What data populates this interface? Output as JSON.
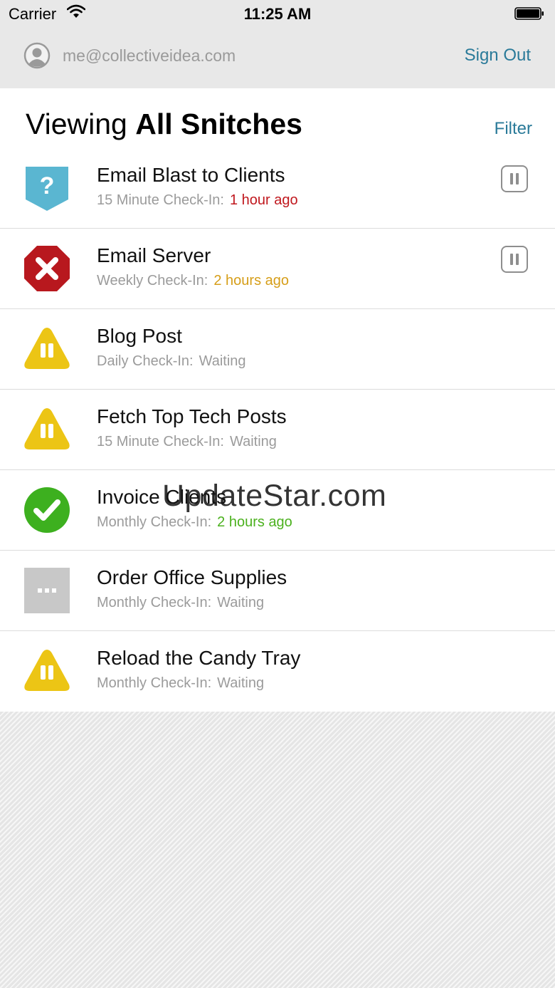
{
  "status_bar": {
    "carrier": "Carrier",
    "time": "11:25 AM",
    "wifi_icon": "wifi-icon",
    "battery_icon": "battery-full-icon"
  },
  "account": {
    "avatar_icon": "user-avatar-icon",
    "email": "me@collectiveidea.com",
    "sign_out_label": "Sign Out"
  },
  "header": {
    "viewing_prefix": "Viewing",
    "viewing_name": "All Snitches",
    "filter_label": "Filter"
  },
  "colors": {
    "link": "#2a7a99",
    "error": "#c0171d",
    "warning": "#d69e19",
    "success": "#4bb11e",
    "paused_yellow": "#ecc515",
    "unknown_blue": "#5ab6d1",
    "pending_gray": "#c8c8c8"
  },
  "snitches": [
    {
      "name": "Email Blast to Clients",
      "interval": "15 Minute Check-In:",
      "ago": "1 hour ago",
      "status": "unknown",
      "status_icon": "question-badge-icon",
      "ago_color": "#c0171d",
      "pause_button": true,
      "pause_icon": "pause-button-icon"
    },
    {
      "name": "Email Server",
      "interval": "Weekly Check-In:",
      "ago": "2 hours ago",
      "status": "error",
      "status_icon": "error-octagon-icon",
      "ago_color": "#d69e19",
      "pause_button": true,
      "pause_icon": "pause-button-icon"
    },
    {
      "name": "Blog Post",
      "interval": "Daily Check-In:",
      "ago": "Waiting",
      "status": "paused",
      "status_icon": "paused-warning-icon",
      "ago_color": "#9b9b9b",
      "pause_button": false
    },
    {
      "name": "Fetch Top Tech Posts",
      "interval": "15 Minute Check-In:",
      "ago": "Waiting",
      "status": "paused",
      "status_icon": "paused-warning-icon",
      "ago_color": "#9b9b9b",
      "pause_button": false
    },
    {
      "name": "Invoice Clients",
      "interval": "Monthly Check-In:",
      "ago": "2 hours ago",
      "status": "healthy",
      "status_icon": "check-circle-icon",
      "ago_color": "#4bb11e",
      "pause_button": false
    },
    {
      "name": "Order Office Supplies",
      "interval": "Monthly Check-In:",
      "ago": "Waiting",
      "status": "pending",
      "status_icon": "pending-dots-icon",
      "ago_color": "#9b9b9b",
      "pause_button": false
    },
    {
      "name": "Reload the Candy Tray",
      "interval": "Monthly Check-In:",
      "ago": "Waiting",
      "status": "paused",
      "status_icon": "paused-warning-icon",
      "ago_color": "#9b9b9b",
      "pause_button": false
    }
  ],
  "watermark": "UpdateStar.com"
}
